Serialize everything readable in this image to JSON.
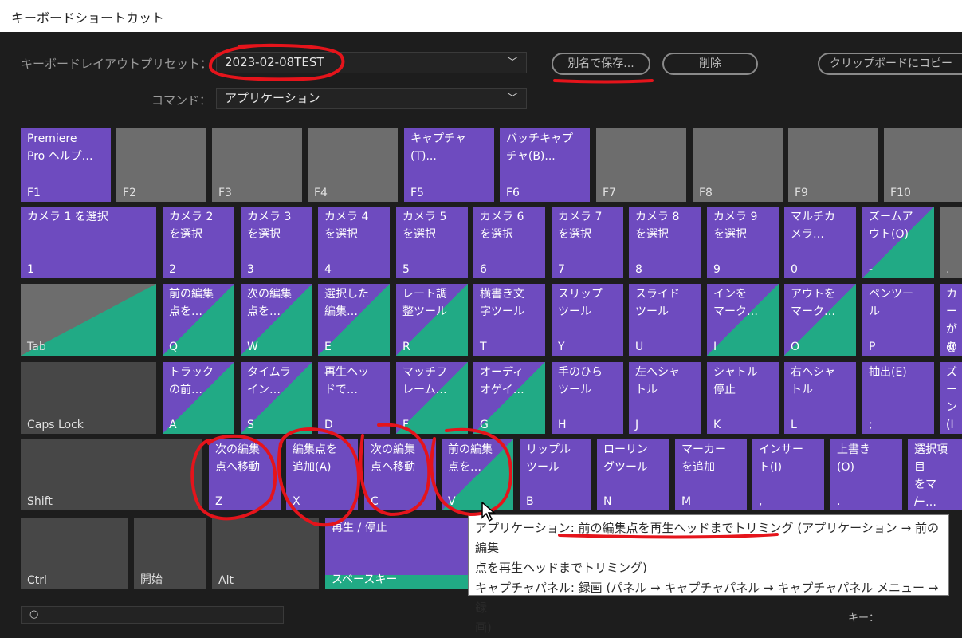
{
  "window": {
    "title": "キーボードショートカット"
  },
  "preset": {
    "label": "キーボードレイアウトプリセット：",
    "value": "2023-02-08TEST"
  },
  "command": {
    "label": "コマンド：",
    "value": "アプリケーション"
  },
  "buttons": {
    "save_as": "別名で保存...",
    "delete": "削除",
    "copy": "クリップボードにコピー"
  },
  "keys": [
    {
      "id": "f1",
      "cmd": "Premiere\nPro ヘルプ…",
      "key": "F1",
      "style": "p"
    },
    {
      "id": "f2",
      "cmd": "",
      "key": "F2",
      "style": "g"
    },
    {
      "id": "f3",
      "cmd": "",
      "key": "F3",
      "style": "g"
    },
    {
      "id": "f4",
      "cmd": "",
      "key": "F4",
      "style": "g"
    },
    {
      "id": "f5",
      "cmd": "キャプチャ\n(T)...",
      "key": "F5",
      "style": "p"
    },
    {
      "id": "f6",
      "cmd": "バッチキャプ\nチャ(B)...",
      "key": "F6",
      "style": "p"
    },
    {
      "id": "f7",
      "cmd": "",
      "key": "F7",
      "style": "g"
    },
    {
      "id": "f8",
      "cmd": "",
      "key": "F8",
      "style": "g"
    },
    {
      "id": "f9",
      "cmd": "",
      "key": "F9",
      "style": "g"
    },
    {
      "id": "f10",
      "cmd": "",
      "key": "F10",
      "style": "g"
    },
    {
      "id": "1",
      "cmd": "カメラ 1 を選択",
      "key": "1",
      "style": "p"
    },
    {
      "id": "2",
      "cmd": "カメラ 2\nを選択",
      "key": "2",
      "style": "p"
    },
    {
      "id": "3",
      "cmd": "カメラ 3\nを選択",
      "key": "3",
      "style": "p"
    },
    {
      "id": "4",
      "cmd": "カメラ 4\nを選択",
      "key": "4",
      "style": "p"
    },
    {
      "id": "5",
      "cmd": "カメラ 5\nを選択",
      "key": "5",
      "style": "p"
    },
    {
      "id": "6",
      "cmd": "カメラ 6\nを選択",
      "key": "6",
      "style": "p"
    },
    {
      "id": "7",
      "cmd": "カメラ 7\nを選択",
      "key": "7",
      "style": "p"
    },
    {
      "id": "8",
      "cmd": "カメラ 8\nを選択",
      "key": "8",
      "style": "p"
    },
    {
      "id": "9",
      "cmd": "カメラ 9\nを選択",
      "key": "9",
      "style": "p"
    },
    {
      "id": "0",
      "cmd": "マルチカ\nメラ…",
      "key": "0",
      "style": "p"
    },
    {
      "id": "minus",
      "cmd": "ズームア\nウト(O)",
      "key": "-",
      "style": "pg"
    },
    {
      "id": "dot",
      "cmd": "",
      "key": ".",
      "style": "g"
    },
    {
      "id": "tab",
      "cmd": "",
      "key": "Tab",
      "style": "gg"
    },
    {
      "id": "q",
      "cmd": "前の編集\n点を…",
      "key": "Q",
      "style": "pg"
    },
    {
      "id": "w",
      "cmd": "次の編集\n点を…",
      "key": "W",
      "style": "pg"
    },
    {
      "id": "e",
      "cmd": "選択した\n編集…",
      "key": "E",
      "style": "pg"
    },
    {
      "id": "r",
      "cmd": "レート調\n整ツール",
      "key": "R",
      "style": "pg"
    },
    {
      "id": "t",
      "cmd": "横書き文\n字ツール",
      "key": "T",
      "style": "p"
    },
    {
      "id": "y",
      "cmd": "スリップ\nツール",
      "key": "Y",
      "style": "p"
    },
    {
      "id": "u",
      "cmd": "スライド\nツール",
      "key": "U",
      "style": "p"
    },
    {
      "id": "i",
      "cmd": "インを\nマーク…",
      "key": "I",
      "style": "pg"
    },
    {
      "id": "o",
      "cmd": "アウトを\nマーク…",
      "key": "O",
      "style": "pg"
    },
    {
      "id": "p",
      "cmd": "ペンツー\nル",
      "key": "P",
      "style": "p"
    },
    {
      "id": "at",
      "cmd": "カー\nがあ",
      "key": "@",
      "style": "p"
    },
    {
      "id": "caps",
      "cmd": "",
      "key": "Caps Lock",
      "style": "gd"
    },
    {
      "id": "a",
      "cmd": "トラック\nの前…",
      "key": "A",
      "style": "pg"
    },
    {
      "id": "s",
      "cmd": "タイムラ\nイン…",
      "key": "S",
      "style": "pg"
    },
    {
      "id": "d",
      "cmd": "再生ヘッ\nドで…",
      "key": "D",
      "style": "p"
    },
    {
      "id": "f",
      "cmd": "マッチフ\nレーム…",
      "key": "F",
      "style": "pg"
    },
    {
      "id": "g",
      "cmd": "オーディ\nオゲイ…",
      "key": "G",
      "style": "pg"
    },
    {
      "id": "h",
      "cmd": "手のひら\nツール",
      "key": "H",
      "style": "p"
    },
    {
      "id": "j",
      "cmd": "左へシャ\nトル",
      "key": "J",
      "style": "p"
    },
    {
      "id": "k",
      "cmd": "シャトル\n停止",
      "key": "K",
      "style": "p"
    },
    {
      "id": "l",
      "cmd": "右へシャ\nトル",
      "key": "L",
      "style": "p"
    },
    {
      "id": "semi",
      "cmd": "抽出(E)",
      "key": ";",
      "style": "p"
    },
    {
      "id": "colon",
      "cmd": "ズー\nン(I",
      "key": ":",
      "style": "p"
    },
    {
      "id": "shift",
      "cmd": "",
      "key": "Shift",
      "style": "gd"
    },
    {
      "id": "z",
      "cmd": "次の編集\n点へ移動",
      "key": "Z",
      "style": "p"
    },
    {
      "id": "x",
      "cmd": "編集点を\n追加(A)",
      "key": "X",
      "style": "p"
    },
    {
      "id": "c",
      "cmd": "次の編集\n点へ移動",
      "key": "C",
      "style": "p"
    },
    {
      "id": "v",
      "cmd": "前の編集\n点を…",
      "key": "V",
      "style": "pg"
    },
    {
      "id": "b",
      "cmd": "リップル\nツール",
      "key": "B",
      "style": "p"
    },
    {
      "id": "n",
      "cmd": "ローリン\nグツール",
      "key": "N",
      "style": "p"
    },
    {
      "id": "m",
      "cmd": "マーカー\nを追加",
      "key": "M",
      "style": "p"
    },
    {
      "id": "comma",
      "cmd": "インサー\nト(I)",
      "key": ",",
      "style": "p"
    },
    {
      "id": "period",
      "cmd": "上書き\n(O)",
      "key": ".",
      "style": "p"
    },
    {
      "id": "slash",
      "cmd": "選択項目\nをマー…",
      "key": "/",
      "style": "p"
    },
    {
      "id": "ctrl",
      "cmd": "",
      "key": "Ctrl",
      "style": "gd"
    },
    {
      "id": "start",
      "cmd": "",
      "key": "開始",
      "style": "gd"
    },
    {
      "id": "alt",
      "cmd": "",
      "key": "Alt",
      "style": "gd"
    },
    {
      "id": "space",
      "cmd": "再生 / 停止",
      "key": "スペースキー",
      "style": "pgb"
    }
  ],
  "tooltip": {
    "line1a": "アプリケーション: ",
    "line1b": "前の編集点を再生ヘッドまでトリミング",
    "line1c": " (アプリケーション → 前の編集",
    "line2": "点を再生ヘッドまでトリミング)",
    "line3": "キャプチャパネル: 録画 (パネル → キャプチャパネル → キャプチャパネル メニュー → 録",
    "line4": "画)"
  },
  "bottom": {
    "key_label": "キー："
  },
  "colors": {
    "purple": "#6e4bbf",
    "green": "#21aa85",
    "annotation_red": "#e5141b"
  }
}
